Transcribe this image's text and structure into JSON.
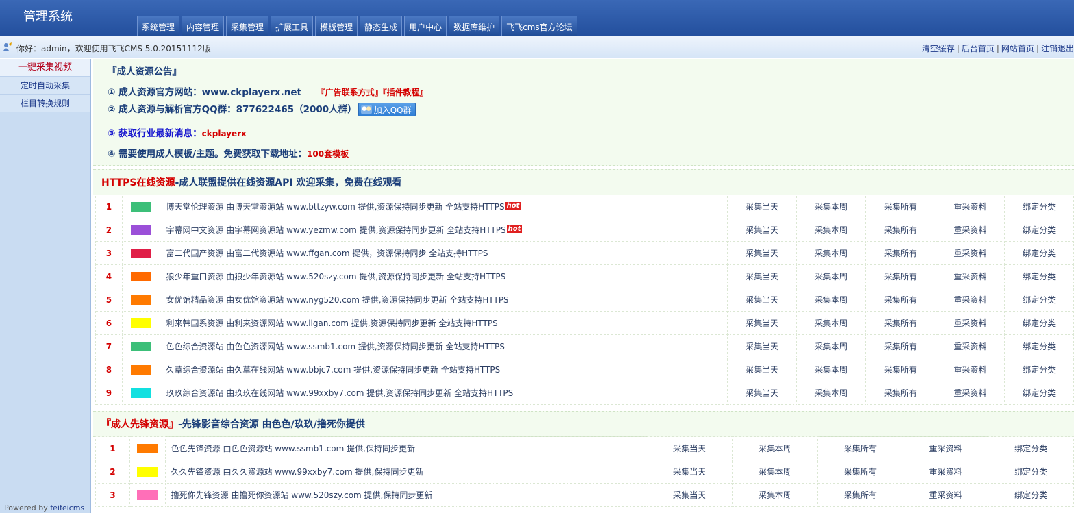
{
  "app_title": "管理系统",
  "nav_tabs": [
    "系统管理",
    "内容管理",
    "采集管理",
    "扩展工具",
    "模板管理",
    "静态生成",
    "用户中心",
    "数据库维护",
    "飞飞cms官方论坛"
  ],
  "welcome": {
    "text": "你好：admin，欢迎使用飞飞CMS 5.0.20151112版",
    "links": [
      "清空缓存",
      "后台首页",
      "网站首页",
      "注销退出"
    ],
    "separator": "|"
  },
  "sidebar": {
    "items": [
      "一键采集视频",
      "定时自动采集",
      "栏目转换规则"
    ],
    "powered_prefix": "Powered by ",
    "powered_brand": "feifeicms"
  },
  "notice": {
    "title": "『成人资源公告』",
    "line1_text": "① 成人资源官方网站：www.ckplayerx.net",
    "line1_link1": "『广告联系方式』",
    "line1_link2": "『插件教程』",
    "line2_text": "② 成人资源与解析官方QQ群：877622465（2000人群）",
    "qq_button": "加入QQ群",
    "line3_label": "③ 获取行业最新消息：",
    "line3_value": "ckplayerx",
    "line4_text": "④ 需要使用成人模板/主题。免费获取下载地址：",
    "line4_link": "100套模板"
  },
  "section1": {
    "title_red": "HTTPS在线资源",
    "title_rest": "-成人联盟提供在线资源API 欢迎采集，免费在线观看",
    "actions": [
      "采集当天",
      "采集本周",
      "采集所有",
      "重采资料",
      "绑定分类"
    ],
    "hot_label": "hot",
    "rows": [
      {
        "num": "1",
        "color": "#3cbf79",
        "text": "博天堂伦理资源 由博天堂资源站 www.bttzyw.com 提供,资源保持同步更新 全站支持HTTPS",
        "hot": true
      },
      {
        "num": "2",
        "color": "#9b4fd8",
        "text": "字幕网中文资源 由字幕网资源站 www.yezmw.com 提供,资源保持同步更新 全站支持HTTPS",
        "hot": true
      },
      {
        "num": "3",
        "color": "#e01e47",
        "text": "富二代国产资源 由富二代资源站 www.ffgan.com 提供，资源保持同步 全站支持HTTPS",
        "hot": false
      },
      {
        "num": "4",
        "color": "#ff6a00",
        "text": "狼少年重口资源 由狼少年资源站 www.520szy.com 提供,资源保持同步更新 全站支持HTTPS",
        "hot": false
      },
      {
        "num": "5",
        "color": "#ff7a00",
        "text": "女优馆精品资源 由女优馆资源站 www.nyg520.com 提供,资源保持同步更新 全站支持HTTPS",
        "hot": false
      },
      {
        "num": "6",
        "color": "#ffff00",
        "text": "利来韩国系资源 由利来资源网站 www.llgan.com 提供,资源保持同步更新 全站支持HTTPS",
        "hot": false
      },
      {
        "num": "7",
        "color": "#3cbf79",
        "text": "色色综合资源站 由色色资源网站 www.ssmb1.com 提供,资源保持同步更新 全站支持HTTPS",
        "hot": false
      },
      {
        "num": "8",
        "color": "#ff7a00",
        "text": "久草综合资源站 由久草在线网站 www.bbjc7.com 提供,资源保持同步更新 全站支持HTTPS",
        "hot": false
      },
      {
        "num": "9",
        "color": "#12e0e0",
        "text": "玖玖综合资源站 由玖玖在线网站 www.99xxby7.com 提供,资源保持同步更新 全站支持HTTPS",
        "hot": false
      }
    ]
  },
  "section2": {
    "title_red": "『成人先锋资源』",
    "title_rest": "-先锋影音综合资源 由色色/玖玖/撸死你提供",
    "actions": [
      "采集当天",
      "采集本周",
      "采集所有",
      "重采资料",
      "绑定分类"
    ],
    "rows": [
      {
        "num": "1",
        "color": "#ff7a00",
        "text": "色色先锋资源 由色色资源站 www.ssmb1.com 提供,保持同步更新"
      },
      {
        "num": "2",
        "color": "#ffff00",
        "text": "久久先锋资源 由久久资源站 www.99xxby7.com 提供,保持同步更新"
      },
      {
        "num": "3",
        "color": "#ff6fb8",
        "text": "撸死你先锋资源 由撸死你资源站 www.520szy.com 提供,保持同步更新"
      }
    ]
  }
}
